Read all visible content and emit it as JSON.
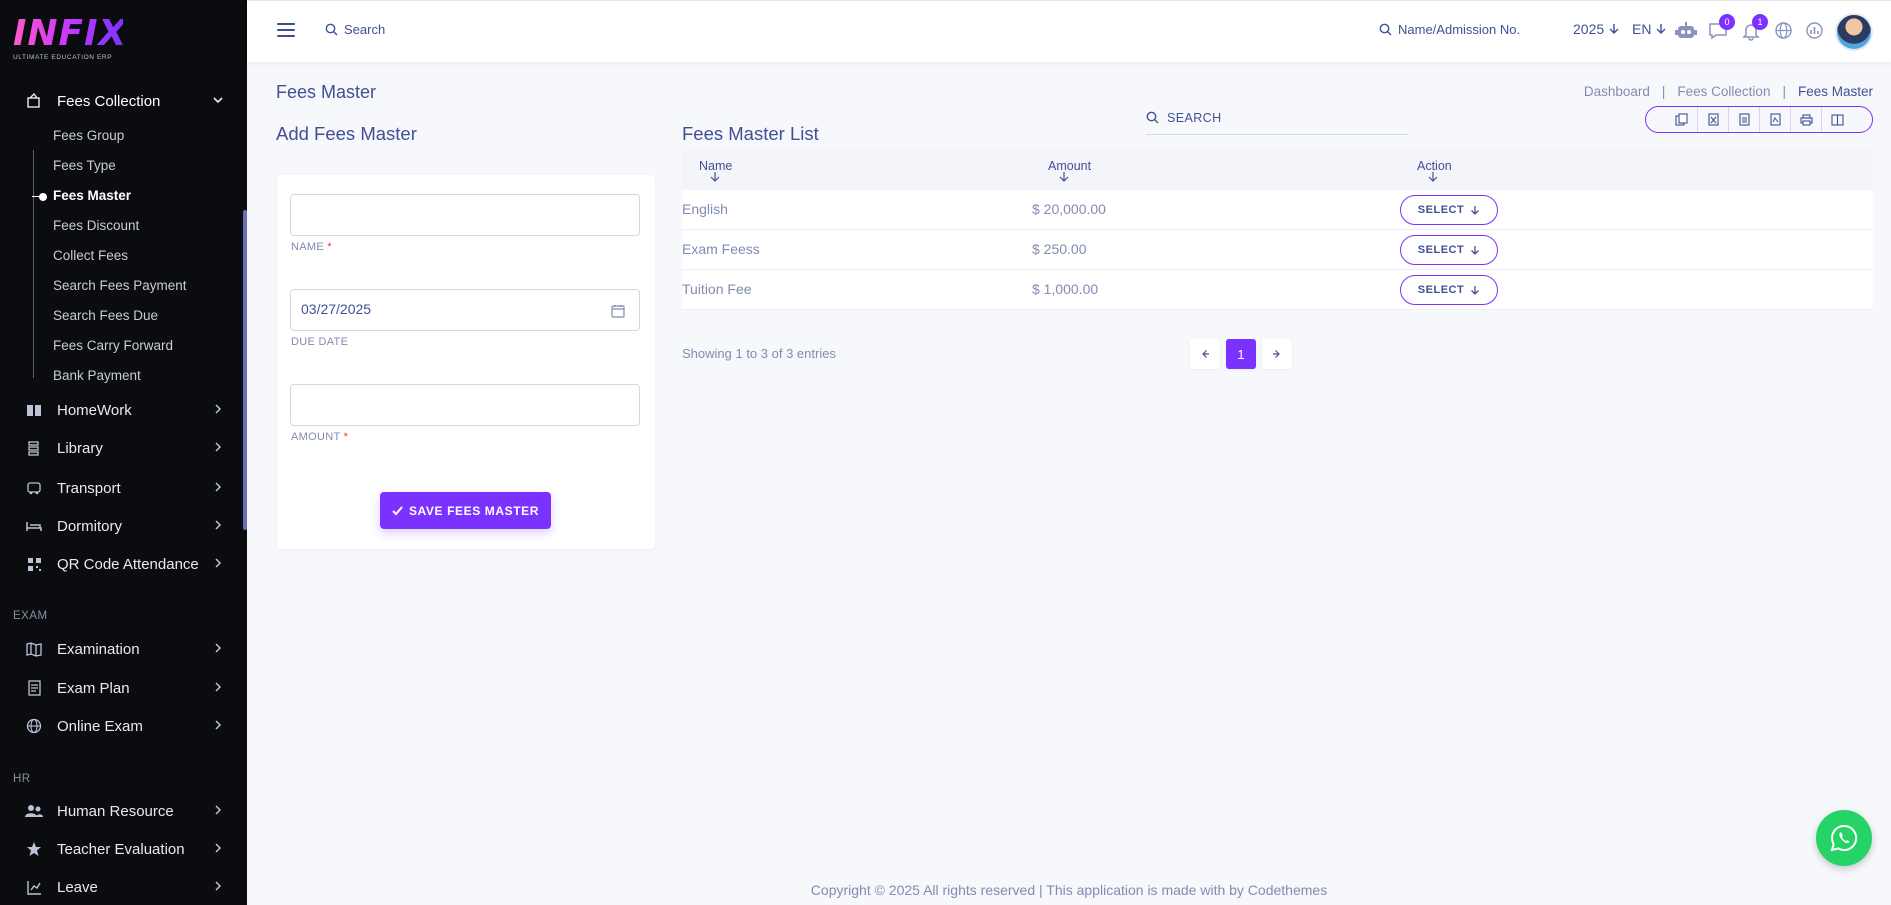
{
  "brand": {
    "logo": "INFIX",
    "tagline": "ULTIMATE EDUCATION ERP"
  },
  "sidebar": {
    "fees_collection": "Fees Collection",
    "sub_items": [
      "Fees Group",
      "Fees Type",
      "Fees Master",
      "Fees Discount",
      "Collect Fees",
      "Search Fees Payment",
      "Search Fees Due",
      "Fees Carry Forward",
      "Bank Payment"
    ],
    "main_items": [
      "HomeWork",
      "Library",
      "Transport",
      "Dormitory",
      "QR Code Attendance"
    ],
    "section_exam": "EXAM",
    "exam_items": [
      "Examination",
      "Exam Plan",
      "Online Exam"
    ],
    "section_hr": "HR",
    "hr_items": [
      "Human Resource",
      "Teacher Evaluation",
      "Leave"
    ]
  },
  "topbar": {
    "search": "Search",
    "admission_search": "Name/Admission No.",
    "year": "2025",
    "lang": "EN",
    "messages_count": "0",
    "notifications_count": "1"
  },
  "page": {
    "title": "Fees Master",
    "breadcrumb": [
      "Dashboard",
      "Fees Collection",
      "Fees Master"
    ]
  },
  "form": {
    "title": "Add Fees Master",
    "name_value": "",
    "name_label": "NAME",
    "due_date_value": "03/27/2025",
    "due_date_label": "DUE DATE",
    "amount_value": "",
    "amount_label": "AMOUNT",
    "required_mark": "*",
    "save_label": "SAVE FEES MASTER"
  },
  "list": {
    "title": "Fees Master List",
    "search_label": "SEARCH",
    "columns": [
      "Name",
      "Amount",
      "Action"
    ],
    "rows": [
      {
        "name": "English",
        "amount": "$ 20,000.00",
        "action": "SELECT"
      },
      {
        "name": "Exam Feess",
        "amount": "$ 250.00",
        "action": "SELECT"
      },
      {
        "name": "Tuition Fee",
        "amount": "$ 1,000.00",
        "action": "SELECT"
      }
    ],
    "showing": "Showing 1 to 3 of 3 entries",
    "current_page": "1"
  },
  "footer": "Copyright © 2025 All rights reserved | This application is made with by Codethemes",
  "colors": {
    "accent": "#7c32ff",
    "text": "#415094",
    "muted": "#828bb2",
    "sidebar": "#0b0c10",
    "whatsapp": "#25d366"
  }
}
